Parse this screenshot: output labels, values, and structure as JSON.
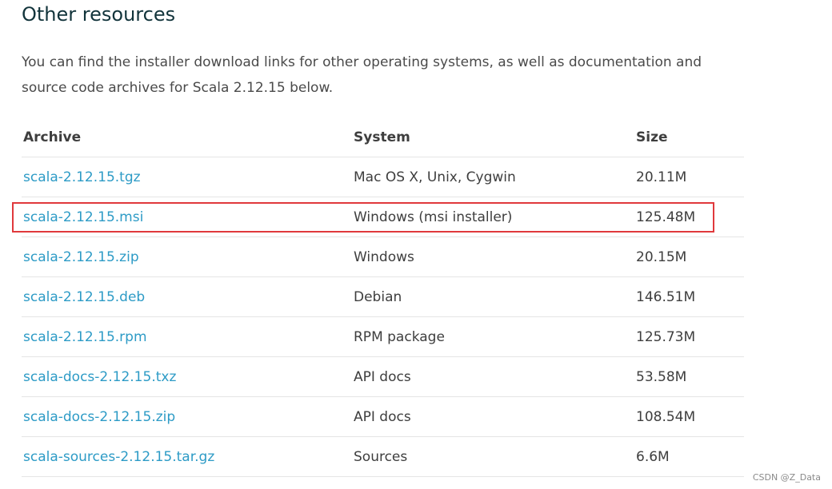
{
  "section": {
    "title": "Other resources",
    "intro": "You can find the installer download links for other operating systems, as well as documentation and source code archives for Scala 2.12.15 below."
  },
  "table": {
    "headers": {
      "archive": "Archive",
      "system": "System",
      "size": "Size"
    },
    "rows": [
      {
        "archive": "scala-2.12.15.tgz",
        "system": "Mac OS X, Unix, Cygwin",
        "size": "20.11M"
      },
      {
        "archive": "scala-2.12.15.msi",
        "system": "Windows (msi installer)",
        "size": "125.48M",
        "highlighted": true
      },
      {
        "archive": "scala-2.12.15.zip",
        "system": "Windows",
        "size": "20.15M"
      },
      {
        "archive": "scala-2.12.15.deb",
        "system": "Debian",
        "size": "146.51M"
      },
      {
        "archive": "scala-2.12.15.rpm",
        "system": "RPM package",
        "size": "125.73M"
      },
      {
        "archive": "scala-docs-2.12.15.txz",
        "system": "API docs",
        "size": "53.58M"
      },
      {
        "archive": "scala-docs-2.12.15.zip",
        "system": "API docs",
        "size": "108.54M"
      },
      {
        "archive": "scala-sources-2.12.15.tar.gz",
        "system": "Sources",
        "size": "6.6M"
      }
    ]
  },
  "watermark": "CSDN @Z_Data",
  "colors": {
    "link": "#2d9bc6",
    "heading": "#12343b",
    "highlight_border": "#e0393c"
  }
}
